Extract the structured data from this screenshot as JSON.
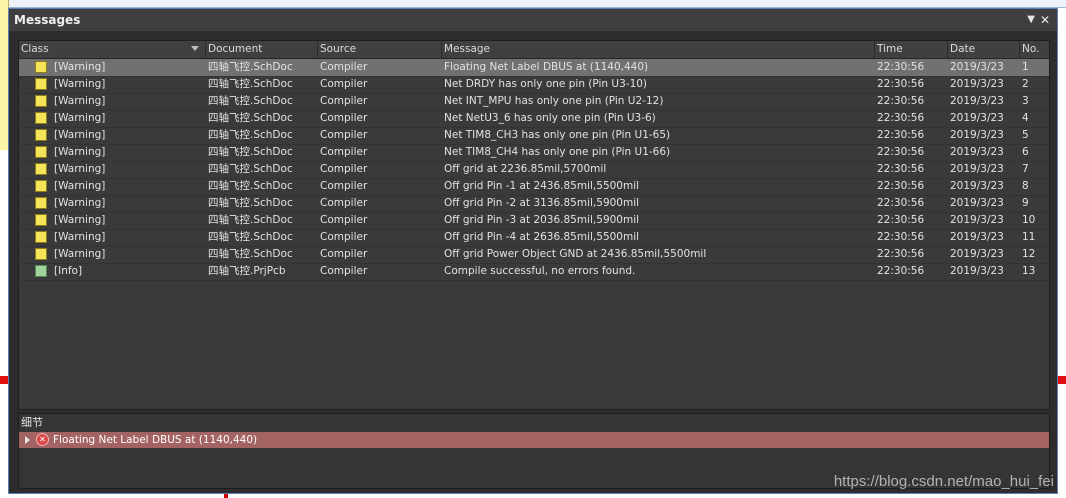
{
  "panel": {
    "title": "Messages",
    "menu_glyph": "▼",
    "close_glyph": "✕"
  },
  "columns": [
    {
      "label": "Class"
    },
    {
      "label": "Document"
    },
    {
      "label": "Source"
    },
    {
      "label": "Message"
    },
    {
      "label": "Time"
    },
    {
      "label": "Date"
    },
    {
      "label": "No."
    }
  ],
  "rows": [
    {
      "kind": "warning",
      "cls": "[Warning]",
      "doc": "四轴飞控.SchDoc",
      "src": "Compiler",
      "msg": "Floating Net Label DBUS at (1140,440)",
      "time": "22:30:56",
      "date": "2019/3/23",
      "no": "1"
    },
    {
      "kind": "warning",
      "cls": "[Warning]",
      "doc": "四轴飞控.SchDoc",
      "src": "Compiler",
      "msg": "Net DRDY has only one pin (Pin U3-10)",
      "time": "22:30:56",
      "date": "2019/3/23",
      "no": "2"
    },
    {
      "kind": "warning",
      "cls": "[Warning]",
      "doc": "四轴飞控.SchDoc",
      "src": "Compiler",
      "msg": "Net INT_MPU has only one pin (Pin U2-12)",
      "time": "22:30:56",
      "date": "2019/3/23",
      "no": "3"
    },
    {
      "kind": "warning",
      "cls": "[Warning]",
      "doc": "四轴飞控.SchDoc",
      "src": "Compiler",
      "msg": "Net NetU3_6 has only one pin (Pin U3-6)",
      "time": "22:30:56",
      "date": "2019/3/23",
      "no": "4"
    },
    {
      "kind": "warning",
      "cls": "[Warning]",
      "doc": "四轴飞控.SchDoc",
      "src": "Compiler",
      "msg": "Net TIM8_CH3 has only one pin (Pin U1-65)",
      "time": "22:30:56",
      "date": "2019/3/23",
      "no": "5"
    },
    {
      "kind": "warning",
      "cls": "[Warning]",
      "doc": "四轴飞控.SchDoc",
      "src": "Compiler",
      "msg": "Net TIM8_CH4 has only one pin (Pin U1-66)",
      "time": "22:30:56",
      "date": "2019/3/23",
      "no": "6"
    },
    {
      "kind": "warning",
      "cls": "[Warning]",
      "doc": "四轴飞控.SchDoc",
      "src": "Compiler",
      "msg": "Off grid  at 2236.85mil,5700mil",
      "time": "22:30:56",
      "date": "2019/3/23",
      "no": "7"
    },
    {
      "kind": "warning",
      "cls": "[Warning]",
      "doc": "四轴飞控.SchDoc",
      "src": "Compiler",
      "msg": "Off grid Pin -1 at 2436.85mil,5500mil",
      "time": "22:30:56",
      "date": "2019/3/23",
      "no": "8"
    },
    {
      "kind": "warning",
      "cls": "[Warning]",
      "doc": "四轴飞控.SchDoc",
      "src": "Compiler",
      "msg": "Off grid Pin -2 at 3136.85mil,5900mil",
      "time": "22:30:56",
      "date": "2019/3/23",
      "no": "9"
    },
    {
      "kind": "warning",
      "cls": "[Warning]",
      "doc": "四轴飞控.SchDoc",
      "src": "Compiler",
      "msg": "Off grid Pin -3 at 2036.85mil,5900mil",
      "time": "22:30:56",
      "date": "2019/3/23",
      "no": "10"
    },
    {
      "kind": "warning",
      "cls": "[Warning]",
      "doc": "四轴飞控.SchDoc",
      "src": "Compiler",
      "msg": "Off grid Pin -4 at 2636.85mil,5500mil",
      "time": "22:30:56",
      "date": "2019/3/23",
      "no": "11"
    },
    {
      "kind": "warning",
      "cls": "[Warning]",
      "doc": "四轴飞控.SchDoc",
      "src": "Compiler",
      "msg": "Off grid Power Object GND at 2436.85mil,5500mil",
      "time": "22:30:56",
      "date": "2019/3/23",
      "no": "12"
    },
    {
      "kind": "info",
      "cls": "[Info]",
      "doc": "四轴飞控.PrjPcb",
      "src": "Compiler",
      "msg": "Compile successful, no errors found.",
      "time": "22:30:56",
      "date": "2019/3/23",
      "no": "13"
    }
  ],
  "selected_row": 1,
  "colors": {
    "warning_icon": "#f5e35a",
    "info_icon": "#9fd49a",
    "selected_bg": "#717171",
    "detail_bg": "#a46363"
  },
  "details": {
    "title": "细节",
    "item": {
      "icon": "error-icon",
      "glyph": "✕",
      "text": "Floating Net Label DBUS at (1140,440)"
    }
  },
  "watermark": "https://blog.csdn.net/mao_hui_fei"
}
